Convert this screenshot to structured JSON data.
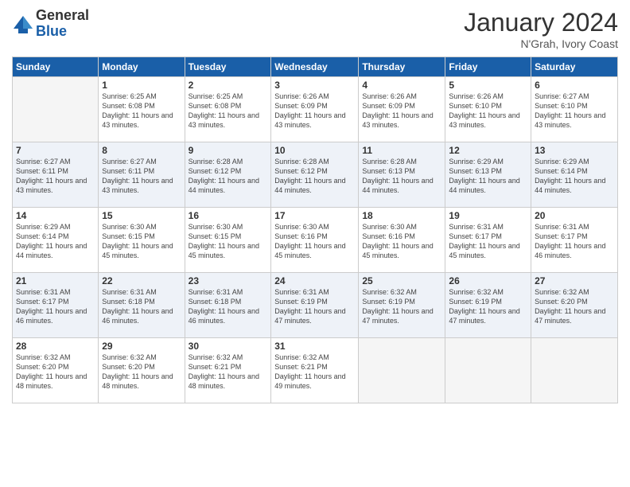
{
  "logo": {
    "general": "General",
    "blue": "Blue"
  },
  "title": "January 2024",
  "location": "N'Grah, Ivory Coast",
  "days_of_week": [
    "Sunday",
    "Monday",
    "Tuesday",
    "Wednesday",
    "Thursday",
    "Friday",
    "Saturday"
  ],
  "weeks": [
    [
      {
        "day": "",
        "sunrise": "",
        "sunset": "",
        "daylight": ""
      },
      {
        "day": "1",
        "sunrise": "Sunrise: 6:25 AM",
        "sunset": "Sunset: 6:08 PM",
        "daylight": "Daylight: 11 hours and 43 minutes."
      },
      {
        "day": "2",
        "sunrise": "Sunrise: 6:25 AM",
        "sunset": "Sunset: 6:08 PM",
        "daylight": "Daylight: 11 hours and 43 minutes."
      },
      {
        "day": "3",
        "sunrise": "Sunrise: 6:26 AM",
        "sunset": "Sunset: 6:09 PM",
        "daylight": "Daylight: 11 hours and 43 minutes."
      },
      {
        "day": "4",
        "sunrise": "Sunrise: 6:26 AM",
        "sunset": "Sunset: 6:09 PM",
        "daylight": "Daylight: 11 hours and 43 minutes."
      },
      {
        "day": "5",
        "sunrise": "Sunrise: 6:26 AM",
        "sunset": "Sunset: 6:10 PM",
        "daylight": "Daylight: 11 hours and 43 minutes."
      },
      {
        "day": "6",
        "sunrise": "Sunrise: 6:27 AM",
        "sunset": "Sunset: 6:10 PM",
        "daylight": "Daylight: 11 hours and 43 minutes."
      }
    ],
    [
      {
        "day": "7",
        "sunrise": "Sunrise: 6:27 AM",
        "sunset": "Sunset: 6:11 PM",
        "daylight": "Daylight: 11 hours and 43 minutes."
      },
      {
        "day": "8",
        "sunrise": "Sunrise: 6:27 AM",
        "sunset": "Sunset: 6:11 PM",
        "daylight": "Daylight: 11 hours and 43 minutes."
      },
      {
        "day": "9",
        "sunrise": "Sunrise: 6:28 AM",
        "sunset": "Sunset: 6:12 PM",
        "daylight": "Daylight: 11 hours and 44 minutes."
      },
      {
        "day": "10",
        "sunrise": "Sunrise: 6:28 AM",
        "sunset": "Sunset: 6:12 PM",
        "daylight": "Daylight: 11 hours and 44 minutes."
      },
      {
        "day": "11",
        "sunrise": "Sunrise: 6:28 AM",
        "sunset": "Sunset: 6:13 PM",
        "daylight": "Daylight: 11 hours and 44 minutes."
      },
      {
        "day": "12",
        "sunrise": "Sunrise: 6:29 AM",
        "sunset": "Sunset: 6:13 PM",
        "daylight": "Daylight: 11 hours and 44 minutes."
      },
      {
        "day": "13",
        "sunrise": "Sunrise: 6:29 AM",
        "sunset": "Sunset: 6:14 PM",
        "daylight": "Daylight: 11 hours and 44 minutes."
      }
    ],
    [
      {
        "day": "14",
        "sunrise": "Sunrise: 6:29 AM",
        "sunset": "Sunset: 6:14 PM",
        "daylight": "Daylight: 11 hours and 44 minutes."
      },
      {
        "day": "15",
        "sunrise": "Sunrise: 6:30 AM",
        "sunset": "Sunset: 6:15 PM",
        "daylight": "Daylight: 11 hours and 45 minutes."
      },
      {
        "day": "16",
        "sunrise": "Sunrise: 6:30 AM",
        "sunset": "Sunset: 6:15 PM",
        "daylight": "Daylight: 11 hours and 45 minutes."
      },
      {
        "day": "17",
        "sunrise": "Sunrise: 6:30 AM",
        "sunset": "Sunset: 6:16 PM",
        "daylight": "Daylight: 11 hours and 45 minutes."
      },
      {
        "day": "18",
        "sunrise": "Sunrise: 6:30 AM",
        "sunset": "Sunset: 6:16 PM",
        "daylight": "Daylight: 11 hours and 45 minutes."
      },
      {
        "day": "19",
        "sunrise": "Sunrise: 6:31 AM",
        "sunset": "Sunset: 6:17 PM",
        "daylight": "Daylight: 11 hours and 45 minutes."
      },
      {
        "day": "20",
        "sunrise": "Sunrise: 6:31 AM",
        "sunset": "Sunset: 6:17 PM",
        "daylight": "Daylight: 11 hours and 46 minutes."
      }
    ],
    [
      {
        "day": "21",
        "sunrise": "Sunrise: 6:31 AM",
        "sunset": "Sunset: 6:17 PM",
        "daylight": "Daylight: 11 hours and 46 minutes."
      },
      {
        "day": "22",
        "sunrise": "Sunrise: 6:31 AM",
        "sunset": "Sunset: 6:18 PM",
        "daylight": "Daylight: 11 hours and 46 minutes."
      },
      {
        "day": "23",
        "sunrise": "Sunrise: 6:31 AM",
        "sunset": "Sunset: 6:18 PM",
        "daylight": "Daylight: 11 hours and 46 minutes."
      },
      {
        "day": "24",
        "sunrise": "Sunrise: 6:31 AM",
        "sunset": "Sunset: 6:19 PM",
        "daylight": "Daylight: 11 hours and 47 minutes."
      },
      {
        "day": "25",
        "sunrise": "Sunrise: 6:32 AM",
        "sunset": "Sunset: 6:19 PM",
        "daylight": "Daylight: 11 hours and 47 minutes."
      },
      {
        "day": "26",
        "sunrise": "Sunrise: 6:32 AM",
        "sunset": "Sunset: 6:19 PM",
        "daylight": "Daylight: 11 hours and 47 minutes."
      },
      {
        "day": "27",
        "sunrise": "Sunrise: 6:32 AM",
        "sunset": "Sunset: 6:20 PM",
        "daylight": "Daylight: 11 hours and 47 minutes."
      }
    ],
    [
      {
        "day": "28",
        "sunrise": "Sunrise: 6:32 AM",
        "sunset": "Sunset: 6:20 PM",
        "daylight": "Daylight: 11 hours and 48 minutes."
      },
      {
        "day": "29",
        "sunrise": "Sunrise: 6:32 AM",
        "sunset": "Sunset: 6:20 PM",
        "daylight": "Daylight: 11 hours and 48 minutes."
      },
      {
        "day": "30",
        "sunrise": "Sunrise: 6:32 AM",
        "sunset": "Sunset: 6:21 PM",
        "daylight": "Daylight: 11 hours and 48 minutes."
      },
      {
        "day": "31",
        "sunrise": "Sunrise: 6:32 AM",
        "sunset": "Sunset: 6:21 PM",
        "daylight": "Daylight: 11 hours and 49 minutes."
      },
      {
        "day": "",
        "sunrise": "",
        "sunset": "",
        "daylight": ""
      },
      {
        "day": "",
        "sunrise": "",
        "sunset": "",
        "daylight": ""
      },
      {
        "day": "",
        "sunrise": "",
        "sunset": "",
        "daylight": ""
      }
    ]
  ]
}
